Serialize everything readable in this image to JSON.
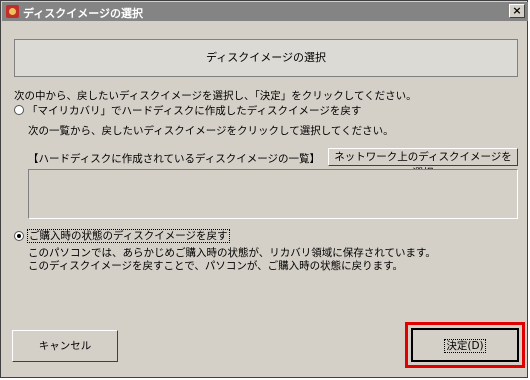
{
  "window": {
    "title": "ディスクイメージの選択",
    "close_label": "×"
  },
  "header": {
    "title": "ディスクイメージの選択"
  },
  "instruction": "次の中から、戻したいディスクイメージを選択し、「決定」をクリックしてください。",
  "option_recovery": {
    "label": "「マイリカバリ」でハードディスクに作成したディスクイメージを戻す",
    "sub": "次の一覧から、戻したいディスクイメージをクリックして選択してください。",
    "list_label": "【ハードディスクに作成されているディスクイメージの一覧】",
    "network_button": "ネットワーク上のディスクイメージを選択",
    "selected": false
  },
  "option_factory": {
    "label": "ご購入時の状態のディスクイメージを戻す",
    "desc1": "このパソコンでは、あらかじめご購入時の状態が、リカバリ領域に保存されています。",
    "desc2": "このディスクイメージを戻すことで、パソコンが、ご購入時の状態に戻ります。",
    "selected": true
  },
  "buttons": {
    "cancel": "キャンセル",
    "ok": "決定(D)"
  }
}
